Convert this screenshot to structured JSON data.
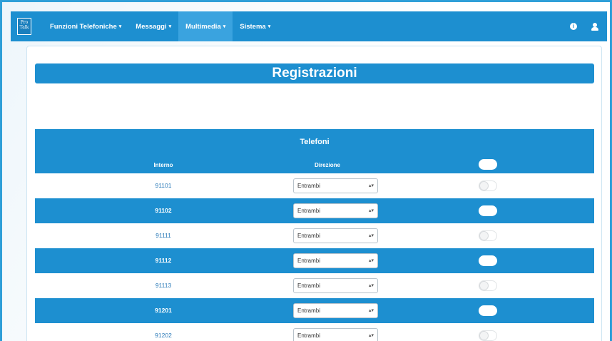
{
  "navbar": {
    "logo_text": "Pro Talk",
    "items": [
      {
        "label": "Funzioni Telefoniche",
        "caret": "▾"
      },
      {
        "label": "Messaggi",
        "caret": "▾"
      },
      {
        "label": "Multimedia",
        "caret": "▾"
      },
      {
        "label": "Sistema",
        "caret": "▾"
      }
    ],
    "active_item": "Multimedia",
    "info_icon": "i",
    "user_icon": "user-icon"
  },
  "page": {
    "title": "Registrazioni"
  },
  "table": {
    "caption": "Telefoni",
    "headers": {
      "interno": "Interno",
      "direzione": "Direzione"
    },
    "header_toggle": "on",
    "rows": [
      {
        "interno": "91101",
        "direzione": "Entrambi",
        "toggle": "off"
      },
      {
        "interno": "91102",
        "direzione": "Entrambi",
        "toggle": "on"
      },
      {
        "interno": "91111",
        "direzione": "Entrambi",
        "toggle": "off"
      },
      {
        "interno": "91112",
        "direzione": "Entrambi",
        "toggle": "on"
      },
      {
        "interno": "91113",
        "direzione": "Entrambi",
        "toggle": "off"
      },
      {
        "interno": "91201",
        "direzione": "Entrambi",
        "toggle": "on"
      },
      {
        "interno": "91202",
        "direzione": "Entrambi",
        "toggle": "off"
      }
    ]
  },
  "colors": {
    "accent": "#1d8fd0",
    "link": "#2a7ab8"
  }
}
